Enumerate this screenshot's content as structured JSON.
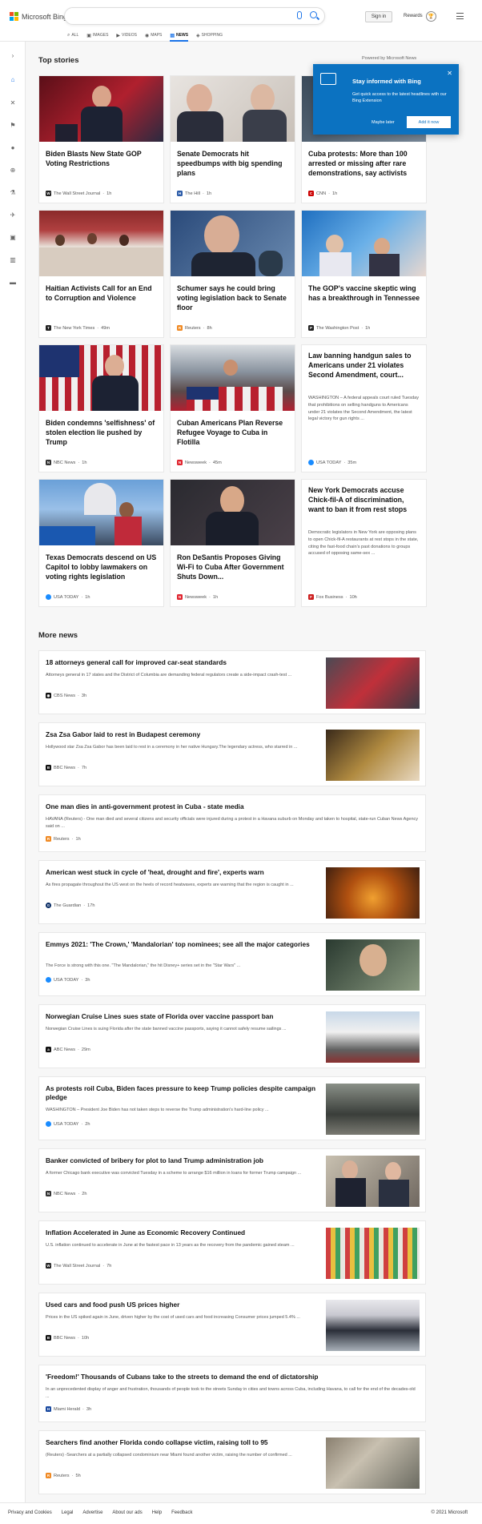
{
  "header": {
    "logo_text": "Microsoft Bing",
    "search_value": "",
    "signin_label": "Sign in",
    "rewards_label": "Rewards",
    "tabs": [
      {
        "label": "ALL",
        "icon": "search-icon"
      },
      {
        "label": "IMAGES",
        "icon": "image-icon"
      },
      {
        "label": "VIDEOS",
        "icon": "video-icon"
      },
      {
        "label": "MAPS",
        "icon": "map-pin-icon"
      },
      {
        "label": "NEWS",
        "icon": "news-icon",
        "active": true
      },
      {
        "label": "SHOPPING",
        "icon": "tag-icon"
      }
    ]
  },
  "sidebar": {
    "icons": [
      "expand-icon",
      "home-icon",
      "sports-icon",
      "flag-icon",
      "location-icon",
      "globe-icon",
      "science-icon",
      "rocket-icon",
      "video-icon",
      "bank-icon",
      "card-icon"
    ]
  },
  "top_stories": {
    "title": "Top stories",
    "powered_by": "Powered by Microsoft News",
    "cards": [
      {
        "title": "Biden Blasts New State GOP Voting Restrictions",
        "source": "The Wall Street Journal",
        "time": "1h",
        "color": "#222"
      },
      {
        "title": "Senate Democrats hit speedbumps with big spending plans",
        "source": "The Hill",
        "time": "1h",
        "color": "#2b5ba8"
      },
      {
        "title": "Cuba protests: More than 100 arrested or missing after rare demonstrations, say activists",
        "source": "CNN",
        "time": "1h",
        "color": "#cc0000"
      },
      {
        "title": "Haitian Activists Call for an End to Corruption and Violence",
        "source": "The New York Times",
        "time": "49m",
        "color": "#222"
      },
      {
        "title": "Schumer says he could bring voting legislation back to Senate floor",
        "source": "Reuters",
        "time": "8h",
        "color": "#f08a24"
      },
      {
        "title": "The GOP's vaccine skeptic wing has a breakthrough in Tennessee",
        "source": "The Washington Post",
        "time": "1h",
        "color": "#222"
      },
      {
        "title": "Biden condemns 'selfishness' of stolen election lie pushed by Trump",
        "source": "NBC News",
        "time": "1h",
        "color": "#333"
      },
      {
        "title": "Cuban Americans Plan Reverse Refugee Voyage to Cuba in Flotilla",
        "source": "Newsweek",
        "time": "45m",
        "color": "#e0242e"
      },
      {
        "title": "Law banning handgun sales to Americans under 21 violates Second Amendment, court...",
        "abstract": "WASHINGTON – A federal appeals court ruled Tuesday that prohibitions on selling handguns to Americans under 21 violates the Second Amendment, the latest legal victory for gun rights ...",
        "source": "USA TODAY",
        "time": "35m",
        "color": "#1a8cff"
      },
      {
        "title": "Texas Democrats descend on US Capitol to lobby lawmakers on voting rights legislation",
        "source": "USA TODAY",
        "time": "1h",
        "color": "#1a8cff"
      },
      {
        "title": "Ron DeSantis Proposes Giving Wi-Fi to Cuba After Government Shuts Down...",
        "source": "Newsweek",
        "time": "1h",
        "color": "#e0242e"
      },
      {
        "title": "New York Democrats accuse Chick-fil-A of discrimination, want to ban it from rest stops",
        "abstract": "Democratic legislators in New York are opposing plans to open Chick-fil-A restaurants at rest stops in the state, citing the fast-food chain's past donations to groups accused of opposing same-sex ...",
        "source": "Fox Business",
        "time": "10h",
        "color": "#cc1e1e"
      }
    ]
  },
  "more_news": {
    "title": "More news",
    "items": [
      {
        "title": "18 attorneys general call for improved car-seat standards",
        "snippet": "Attorneys general in 17 states and the District of Columbia are demanding federal regulators create a side-impact crash-test ...",
        "source": "CBS News",
        "time": "3h",
        "color": "#111"
      },
      {
        "title": "Zsa Zsa Gabor laid to rest in Budapest ceremony",
        "snippet": "Hollywood star Zsa Zsa Gabor has been laid to rest in a ceremony in her native Hungary.The legendary actress, who starred in ...",
        "source": "BBC News",
        "time": "7h",
        "color": "#111"
      },
      {
        "title": "One man dies in anti-government protest in Cuba - state media",
        "snippet": "HAVANA (Reuters) - One man died and several citizens and security officials were injured during a protest in a Havana suburb on Monday and taken to hospital, state-run Cuban News Agency said on ...",
        "source": "Reuters",
        "time": "1h",
        "color": "#f08a24"
      },
      {
        "title": "American west stuck in cycle of 'heat, drought and fire', experts warn",
        "snippet": "As fires propagate throughout the US west on the heels of record heatwaves, experts are warning that the region is caught in ...",
        "source": "The Guardian",
        "time": "17h",
        "color": "#052962"
      },
      {
        "title": "Emmys 2021: 'The Crown,' 'Mandalorian' top nominees; see all the major categories",
        "snippet": "The Force is strong with this one.  \"The Mandalorian,\" the hit Disney+ series set in the \"Star Wars\" ...",
        "source": "USA TODAY",
        "time": "3h",
        "color": "#1a8cff"
      },
      {
        "title": "Norwegian Cruise Lines sues state of Florida over vaccine passport ban",
        "snippet": "Norwegian Cruise Lines is suing Florida after the state banned vaccine passports, saying it cannot safely resume sailings ...",
        "source": "ABC News",
        "time": "29m",
        "color": "#111"
      },
      {
        "title": "As protests roil Cuba, Biden faces pressure to keep Trump policies despite campaign pledge",
        "snippet": "WASHINGTON – President Joe Biden has not taken steps to reverse the Trump administration's hard-line policy ...",
        "source": "USA TODAY",
        "time": "2h",
        "color": "#1a8cff"
      },
      {
        "title": "Banker convicted of bribery for plot to land Trump administration job",
        "snippet": "A former Chicago bank executive was convicted Tuesday in a scheme to arrange $16 million in loans for former Trump campaign ...",
        "source": "NBC News",
        "time": "2h",
        "color": "#333"
      },
      {
        "title": "Inflation Accelerated in June as Economic Recovery Continued",
        "snippet": "U.S. inflation continued to accelerate in June at the fastest pace in 13 years as the recovery from the pandemic gained steam ...",
        "source": "The Wall Street Journal",
        "time": "7h",
        "color": "#222"
      },
      {
        "title": "Used cars and food push US prices higher",
        "snippet": "Prices in the US spiked again in June, driven higher by the cost of used cars and food increasing Consumer prices jumped 5.4% ...",
        "source": "BBC News",
        "time": "10h",
        "color": "#111"
      },
      {
        "title": "'Freedom!' Thousands of Cubans take to the streets to demand the end of dictatorship",
        "snippet": "In an unprecedented display of anger and frustration, thousands of people took to the streets Sunday in cities and towns across Cuba, including Havana, to call for the end of the decades-old ...",
        "source": "Miami Herald",
        "time": "3h",
        "color": "#1a4aa0"
      },
      {
        "title": "Searchers find another Florida condo collapse victim, raising toll to 95",
        "snippet": "(Reuters) -Searchers at a partially collapsed condominium near Miami found another victim, raising the number of confirmed ...",
        "source": "Reuters",
        "time": "5h",
        "color": "#f08a24"
      }
    ]
  },
  "popup": {
    "title": "Stay informed with Bing",
    "body": "Get quick access to the latest headlines with our Bing Extension",
    "later_label": "Maybe later",
    "add_label": "Add it now"
  },
  "footer": {
    "links": [
      "Privacy and Cookies",
      "Legal",
      "Advertise",
      "About our ads",
      "Help",
      "Feedback"
    ],
    "copyright": "© 2021 Microsoft"
  }
}
